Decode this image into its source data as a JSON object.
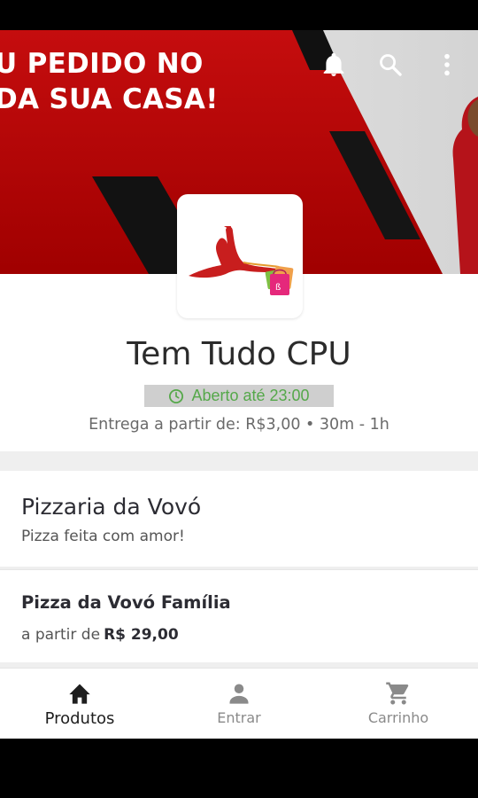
{
  "banner": {
    "line1": "U PEDIDO NO",
    "line2": "DA SUA CASA!"
  },
  "toolbar": {
    "icons": [
      "bell-icon",
      "search-icon",
      "more-vert-icon"
    ]
  },
  "store": {
    "name": "Tem Tudo CPU",
    "status": "Aberto até 23:00",
    "delivery": "Entrega a partir de: R$3,00 • 30m - 1h",
    "status_color": "#55a84a"
  },
  "category": {
    "title": "Pizzaria da Vovó",
    "description": "Pizza feita com amor!"
  },
  "product": {
    "name": "Pizza da Vovó Família",
    "price_prefix": "a partir de",
    "price": "R$ 29,00"
  },
  "nav": {
    "products": "Produtos",
    "login": "Entrar",
    "cart": "Carrinho"
  },
  "colors": {
    "banner_red": "#c40f10",
    "accent": "#55a84a"
  }
}
